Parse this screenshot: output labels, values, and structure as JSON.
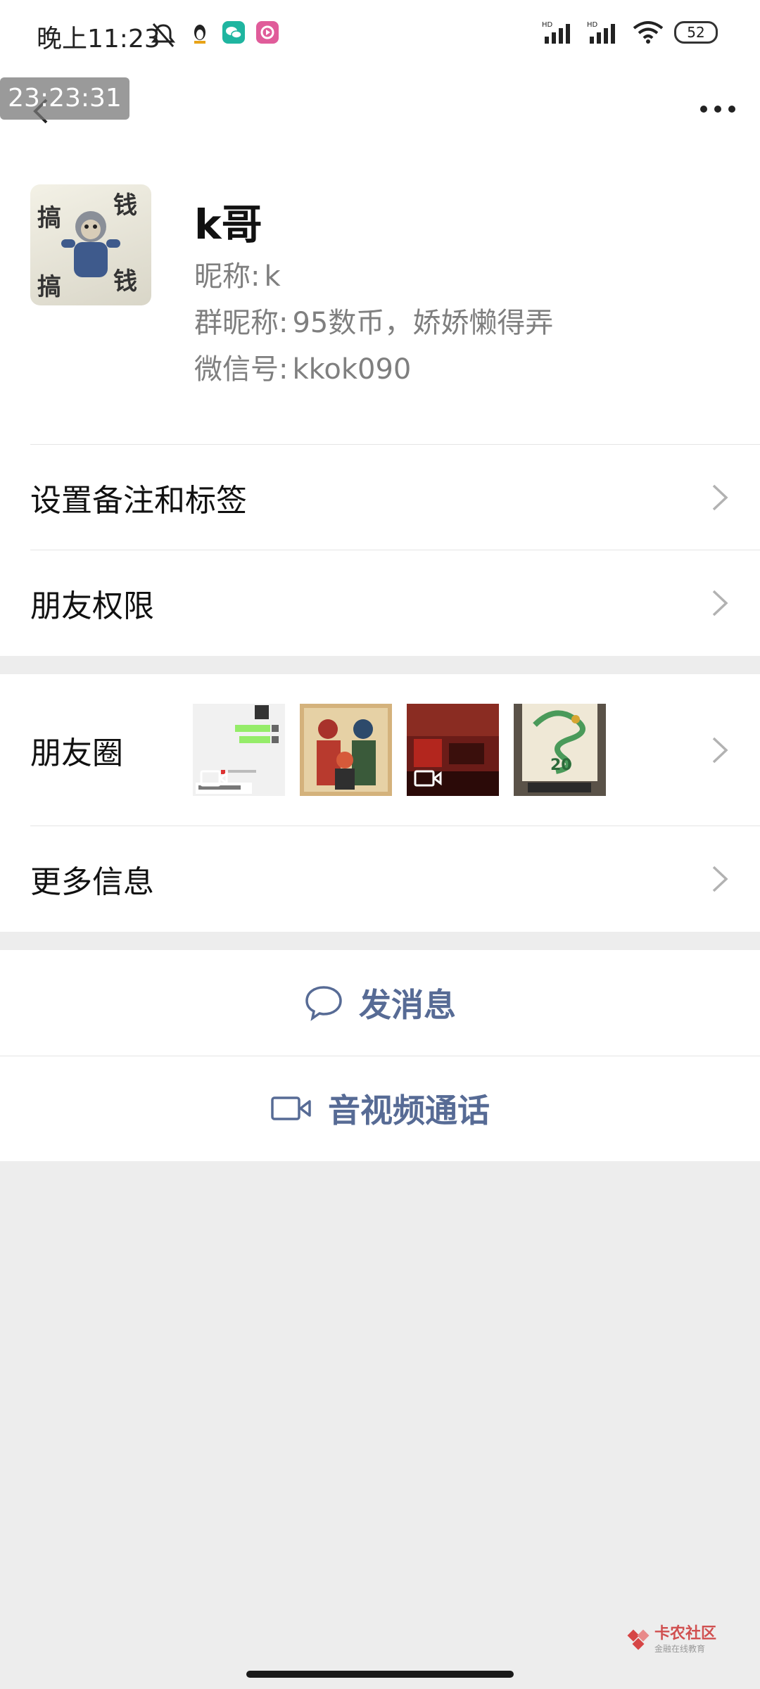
{
  "status_bar": {
    "time": "晚上11:23",
    "battery": "52",
    "signal_label_1": "HD",
    "signal_label_2": "HD"
  },
  "overlay_timestamp": "23:23:31",
  "profile": {
    "display_name": "k哥",
    "nickname_label": "昵称:",
    "nickname": "k",
    "group_nickname_label": "群昵称:",
    "group_nickname": "95数币，娇娇懒得弄",
    "wechat_id_label": "微信号:",
    "wechat_id": "kkok090",
    "avatar_text": [
      "搞",
      "钱",
      "搞",
      "钱"
    ]
  },
  "menu": {
    "remarks_tags": "设置备注和标签",
    "friend_permissions": "朋友权限",
    "moments": "朋友圈",
    "more_info": "更多信息"
  },
  "moments_thumbs": [
    {
      "desc": "chat-screenshot",
      "video": true
    },
    {
      "desc": "door-gods-painting",
      "video": false
    },
    {
      "desc": "red-room",
      "video": true
    },
    {
      "desc": "dragon-picture",
      "video": false,
      "text": "20"
    }
  ],
  "actions": {
    "send_message": "发消息",
    "av_call": "音视频通话"
  },
  "watermark": {
    "title": "卡农社区",
    "subtitle": "金融在线教育"
  },
  "colors": {
    "link_blue": "#576b95",
    "background": "#ededed"
  }
}
